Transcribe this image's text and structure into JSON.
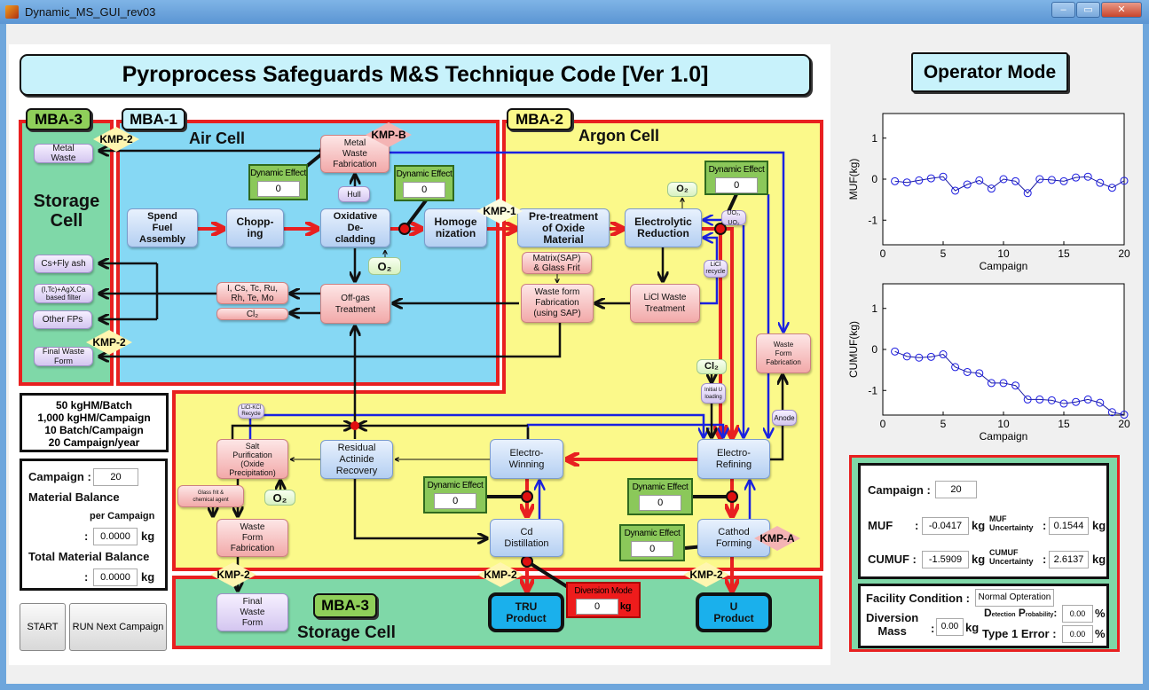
{
  "window": {
    "title": "Dynamic_MS_GUI_rev03",
    "minimize": "‒",
    "maximize": "▭",
    "close": "✕"
  },
  "header": {
    "title": "Pyroprocess Safeguards M&S Technique Code [Ver 1.0]",
    "mode": "Operator Mode"
  },
  "diagram": {
    "mba3_top": "MBA-3",
    "mba1": "MBA-1",
    "mba2": "MBA-2",
    "mba3_bottom": "MBA-3",
    "air_cell": "Air Cell",
    "argon_cell": "Argon Cell",
    "storage_cell_left": "Storage\nCell",
    "storage_cell_bottom": "Storage Cell",
    "nodes": {
      "metal_waste": "Metal\nWaste",
      "cs_fly_ash": "Cs+Fly ash",
      "filter": "(I,Tc)+AgX,Ca\nbased filter",
      "other_fps": "Other FPs",
      "final_waste_form_left": "Final Waste\nForm",
      "spend_fuel": "Spend\nFuel\nAssembly",
      "chopping": "Chopp-\ning",
      "oxidative": "Oxidative\nDe-\ncladding",
      "homogenization": "Homoge\nnization",
      "metal_waste_fab": "Metal\nWaste\nFabrication",
      "hull": "Hull",
      "o2_air": "O₂",
      "fission_gases": "I, Cs, Tc, Ru,\nRh, Te, Mo",
      "cl2_air": "Cl₂",
      "offgas": "Off-gas\nTreatment",
      "pretreatment": "Pre-treatment\nof Oxide\nMaterial",
      "electrolytic": "Electrolytic\nReduction",
      "o2_argon": "O₂",
      "uo2": "UO₂, UO₂",
      "matrix": "Matrix(SAP)\n& Glass Frit",
      "waste_form_sap": "Waste form\nFabrication\n(using SAP)",
      "licl_waste": "LiCl Waste\nTreatment",
      "licl_recycle": "LiCl\nrecycle",
      "waste_form_right": "Waste\nForm\nFabrication",
      "cl2_argon": "Cl₂",
      "initial_u": "Initial U\nloading",
      "anode": "Anode",
      "licl_kcl": "LiCl-KCl\nRecycle",
      "salt_purification": "Salt\nPurification\n(Oxide\nPrecipitation)",
      "residual_actinide": "Residual\nActinide\nRecovery",
      "electro_winning": "Electro-\nWinning",
      "electro_refining": "Electro-\nRefining",
      "glass_frit": "Glass frit &\nchemical agent",
      "o2_lower": "O₂",
      "waste_form_fab": "Waste\nForm\nFabrication",
      "cd_distillation": "Cd\nDistillation",
      "cathode_forming": "Cathod\nForming",
      "final_waste_form_bottom": "Final\nWaste\nForm",
      "tru_product": "TRU\nProduct",
      "u_product": "U\nProduct"
    },
    "kmp": {
      "kmp2_metal": "KMP-2",
      "kmp2_final": "KMP-2",
      "kmp_b": "KMP-B",
      "kmp1": "KMP-1",
      "kmp_a": "KMP-A",
      "kmp2_waste": "KMP-2",
      "kmp2_tru": "KMP-2",
      "kmp2_u": "KMP-2"
    },
    "dynamic_effect_label": "Dynamic Effect",
    "dynamic_effects": {
      "metal_waste": "0",
      "decladding": "0",
      "electrolytic": "0",
      "electro_winning": "0",
      "electro_refining": "0",
      "cathode": "0"
    },
    "diversion": {
      "label": "Diversion Mode",
      "value": "0",
      "unit": "kg"
    }
  },
  "info": {
    "l1": "50 kgHM/Batch",
    "l2": "1,000 kgHM/Campaign",
    "l3": "10 Batch/Campaign",
    "l4": "20 Campaign/year"
  },
  "balance": {
    "campaign_label": "Campaign :",
    "campaign": "20",
    "mb_label": "Material Balance",
    "per_campaign": "per Campaign",
    "colon": ":",
    "mb_value": "0.0000",
    "unit": "kg",
    "total_label": "Total Material Balance",
    "total_value": "0.0000"
  },
  "buttons": {
    "start": "START",
    "run_next": "RUN Next Campaign"
  },
  "results": {
    "campaign_label": "Campaign :",
    "campaign": "20",
    "muf_label": "MUF",
    "colon": ":",
    "muf": "-0.0417",
    "unit": "kg",
    "muf_unc_label1": "MUF",
    "muf_unc_label2": "Uncertainty",
    "muf_unc": "0.1544",
    "cumuf_label": "CUMUF :",
    "cumuf": "-1.5909",
    "cumuf_unc_label1": "CUMUF",
    "cumuf_unc_label2": "Uncertainty",
    "cumuf_unc": "2.6137",
    "facility_label": "Facility Condition :",
    "facility": "Normal Opteration",
    "diversion_label": "Diversion\nMass",
    "diversion": "0.00",
    "det_big1": "D",
    "det_small1": "etection",
    "det_big2": "P",
    "det_small2": "robability",
    "detection": "0.00",
    "pct": "%",
    "type1_label": "Type 1 Error :",
    "type1": "0.00"
  },
  "colors": {
    "red_flow": "#e82020",
    "blue_flow": "#1a22e0",
    "air_cell": "#86d8f4",
    "argon_cell": "#fbf98a",
    "storage": "#7fd8a8",
    "boundary": "#e82020"
  },
  "chart_data": [
    {
      "type": "line",
      "xlabel": "Campaign",
      "ylabel": "MUF(kg)",
      "xlim": [
        0,
        20
      ],
      "ylim": [
        -1.6,
        1.6
      ],
      "xticks": [
        0,
        5,
        10,
        15,
        20
      ],
      "yticks": [
        1,
        0,
        -1
      ],
      "marker": "circle",
      "color": "#1a1aa0",
      "x": [
        1,
        2,
        3,
        4,
        5,
        6,
        7,
        8,
        9,
        10,
        11,
        12,
        13,
        14,
        15,
        16,
        17,
        18,
        19,
        20
      ],
      "values": [
        -0.05,
        -0.08,
        -0.03,
        0.02,
        0.06,
        -0.28,
        -0.13,
        -0.03,
        -0.23,
        0.0,
        -0.05,
        -0.34,
        0.0,
        -0.02,
        -0.05,
        0.04,
        0.06,
        -0.09,
        -0.21,
        -0.04
      ]
    },
    {
      "type": "line",
      "xlabel": "Campaign",
      "ylabel": "CUMUF(kg)",
      "xlim": [
        0,
        20
      ],
      "ylim": [
        -1.6,
        1.6
      ],
      "xticks": [
        0,
        5,
        10,
        15,
        20
      ],
      "yticks": [
        1,
        0,
        -1
      ],
      "marker": "circle",
      "color": "#1a1aa0",
      "x": [
        1,
        2,
        3,
        4,
        5,
        6,
        7,
        8,
        9,
        10,
        11,
        12,
        13,
        14,
        15,
        16,
        17,
        18,
        19,
        20
      ],
      "values": [
        -0.05,
        -0.17,
        -0.2,
        -0.18,
        -0.12,
        -0.43,
        -0.55,
        -0.58,
        -0.82,
        -0.82,
        -0.88,
        -1.22,
        -1.22,
        -1.24,
        -1.32,
        -1.28,
        -1.22,
        -1.3,
        -1.53,
        -1.59
      ]
    }
  ]
}
